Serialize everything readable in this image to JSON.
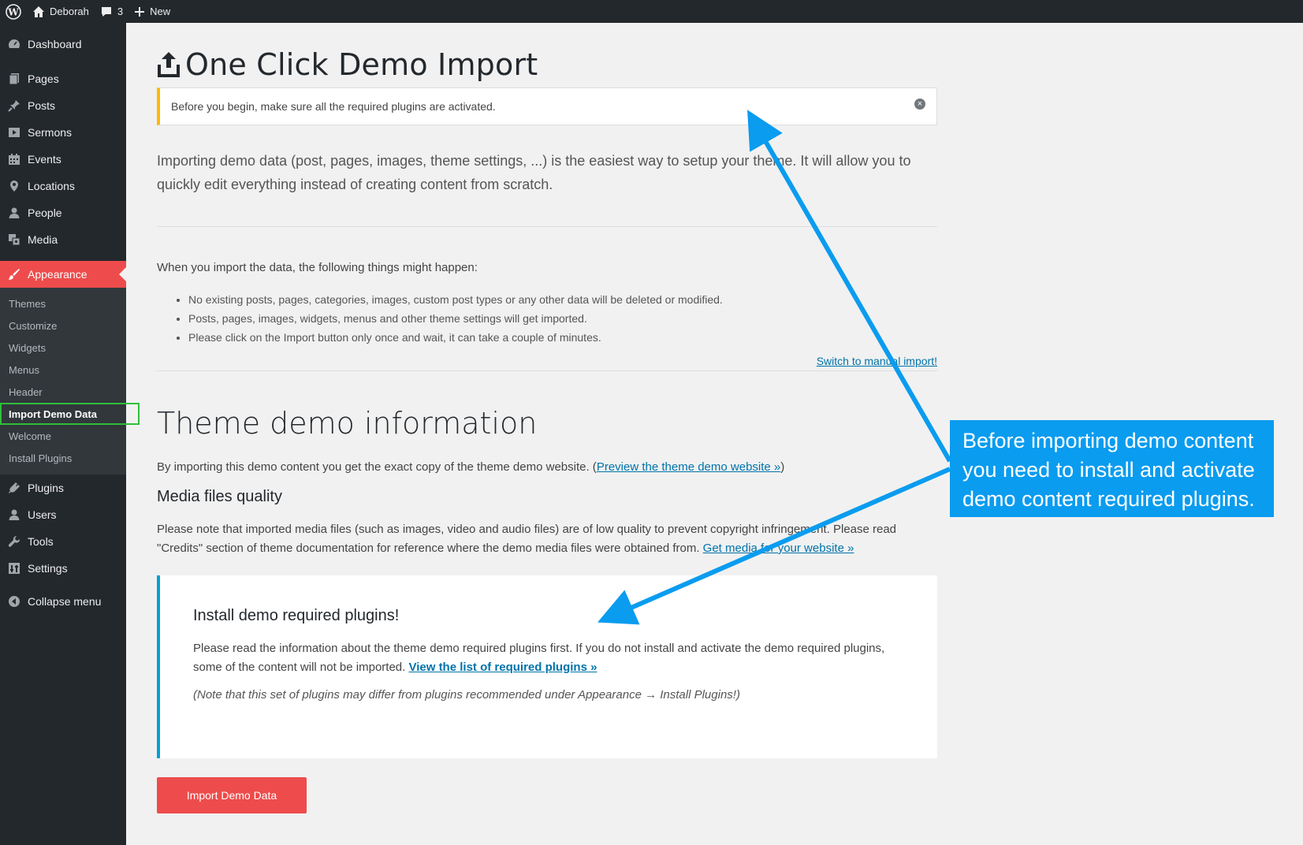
{
  "adminbar": {
    "site_name": "Deborah",
    "comments_count": "3",
    "new_label": "New"
  },
  "sidebar": {
    "items": [
      {
        "label": "Dashboard",
        "icon": "dashboard-icon"
      },
      {
        "label": "Pages",
        "icon": "pages-icon"
      },
      {
        "label": "Posts",
        "icon": "pin-icon"
      },
      {
        "label": "Sermons",
        "icon": "video-icon"
      },
      {
        "label": "Events",
        "icon": "calendar-icon"
      },
      {
        "label": "Locations",
        "icon": "location-pin-icon"
      },
      {
        "label": "People",
        "icon": "person-icon"
      },
      {
        "label": "Media",
        "icon": "media-icon"
      },
      {
        "label": "Appearance",
        "icon": "brush-icon"
      },
      {
        "label": "Plugins",
        "icon": "plugin-icon"
      },
      {
        "label": "Users",
        "icon": "users-icon"
      },
      {
        "label": "Tools",
        "icon": "wrench-icon"
      },
      {
        "label": "Settings",
        "icon": "settings-icon"
      },
      {
        "label": "Collapse menu",
        "icon": "collapse-icon"
      }
    ],
    "submenu": [
      "Themes",
      "Customize",
      "Widgets",
      "Menus",
      "Header",
      "Import Demo Data",
      "Welcome",
      "Install Plugins"
    ]
  },
  "main": {
    "title": "One Click Demo Import",
    "notice": "Before you begin, make sure all the required plugins are activated.",
    "intro": "Importing demo data (post, pages, images, theme settings, ...) is the easiest way to setup your theme. It will allow you to quickly edit everything instead of creating content from scratch.",
    "happen_intro": "When you import the data, the following things might happen:",
    "happen_list": [
      "No existing posts, pages, categories, images, custom post types or any other data will be deleted or modified.",
      "Posts, pages, images, widgets, menus and other theme settings will get imported.",
      "Please click on the Import button only once and wait, it can take a couple of minutes."
    ],
    "switch_link": "Switch to manual import!",
    "demo_heading": "Theme demo information",
    "demo_text": "By importing this demo content you get the exact copy of the theme demo website. (",
    "demo_link": "Preview the theme demo website »",
    "demo_text_end": ")",
    "media_heading": "Media files quality",
    "media_text": "Please note that imported media files (such as images, video and audio files) are of low quality to prevent copyright infringement. Please read \"Credits\" section of theme documentation for reference where the demo media files were obtained from.",
    "media_link": "Get media for your website »",
    "box": {
      "heading": "Install demo required plugins!",
      "text": "Please read the information about the theme demo required plugins first. If you do not install and activate the demo required plugins, some of the content will not be imported.",
      "link": "View the list of required plugins »",
      "note": "(Note that this set of plugins may differ from plugins recommended under Appearance → Install Plugins!)"
    },
    "import_button": "Import Demo Data"
  },
  "callout": {
    "text": "Before importing demo content you need to install and activate demo content required plugins."
  },
  "colors": {
    "accent": "#ee4c4c",
    "sidebar": "#23282d",
    "callout": "#0a9cef",
    "link": "#0073aa"
  }
}
